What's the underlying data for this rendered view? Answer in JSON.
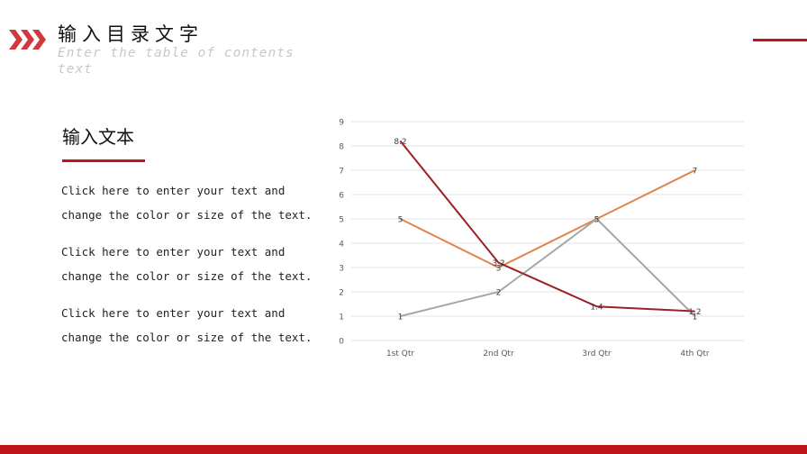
{
  "header": {
    "title": "输入目录文字",
    "subtitle": "Enter the table of contents text",
    "icon": "chevrons-right-icon",
    "accent": "#c0141b"
  },
  "content": {
    "heading": "输入文本",
    "paragraphs": [
      "Click here to enter your text and change the color or size of the text.",
      "Click here to enter your text and change the color or size of the text.",
      "Click here to enter your text and change the color or size of the text."
    ]
  },
  "chart_data": {
    "type": "line",
    "categories": [
      "1st Qtr",
      "2nd Qtr",
      "3rd Qtr",
      "4th Qtr"
    ],
    "ylim": [
      0,
      9
    ],
    "yticks": [
      "0",
      "1",
      "2",
      "3",
      "4",
      "5",
      "6",
      "7",
      "8",
      "9"
    ],
    "grid": true,
    "data_labels": true,
    "series": [
      {
        "values": [
          5,
          3,
          5,
          7
        ],
        "color": "#e0844a",
        "labels": [
          "5",
          "3",
          "5",
          "7"
        ]
      },
      {
        "values": [
          1,
          2,
          5,
          1
        ],
        "color": "#a6a6a6",
        "labels": [
          "1",
          "2",
          "5",
          "1"
        ]
      },
      {
        "values": [
          8.2,
          3.2,
          1.4,
          1.2
        ],
        "color": "#9b2226",
        "labels": [
          "8.2",
          "3.2",
          "1.4",
          "1.2"
        ]
      }
    ]
  }
}
